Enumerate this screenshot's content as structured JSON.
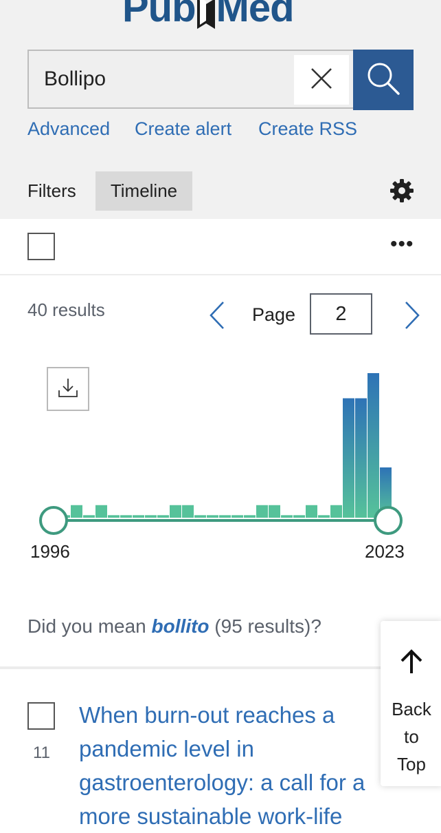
{
  "logo": {
    "left": "Pub",
    "right": "Med",
    "reg": "®"
  },
  "search": {
    "value": "Bollipo",
    "clear_icon": "close-icon",
    "submit_icon": "search-icon"
  },
  "links": {
    "advanced": "Advanced",
    "create_alert": "Create alert",
    "create_rss": "Create RSS"
  },
  "filters": {
    "filters_label": "Filters",
    "timeline_label": "Timeline",
    "settings_icon": "gear-icon"
  },
  "toolbar": {
    "more_label": "•••"
  },
  "results": {
    "count": "40 results",
    "page_label": "Page",
    "page_value": "2"
  },
  "chart_data": {
    "type": "bar",
    "x": [
      1996,
      1997,
      1998,
      1999,
      2000,
      2001,
      2002,
      2003,
      2004,
      2005,
      2006,
      2007,
      2008,
      2009,
      2010,
      2011,
      2012,
      2013,
      2014,
      2015,
      2016,
      2017,
      2018,
      2019,
      2020,
      2021,
      2022,
      2023
    ],
    "values": [
      0.2,
      0.2,
      1,
      0.2,
      1,
      0.2,
      0.2,
      0.2,
      0.2,
      0.2,
      1,
      1,
      0.2,
      0.2,
      0.2,
      0.2,
      0.2,
      1,
      1,
      0.2,
      0.2,
      1,
      0.2,
      1,
      9.5,
      9.5,
      11.5,
      4
    ],
    "start_label": "1996",
    "end_label": "2023",
    "colors": {
      "top": "#2e73b6",
      "bottom": "#56c29a",
      "slider": "#3e9a7f"
    }
  },
  "suggestion": {
    "prefix": "Did you mean ",
    "term": "bollito",
    "suffix": " (95 results)?"
  },
  "result": {
    "number": "11",
    "title_lines": [
      "When burn-out reaches a",
      "pandemic level in",
      "gastroenterology: a call for a",
      "more sustainable work-life"
    ]
  },
  "back_to_top": {
    "line1": "Back",
    "line2": "to",
    "line3": "Top"
  }
}
